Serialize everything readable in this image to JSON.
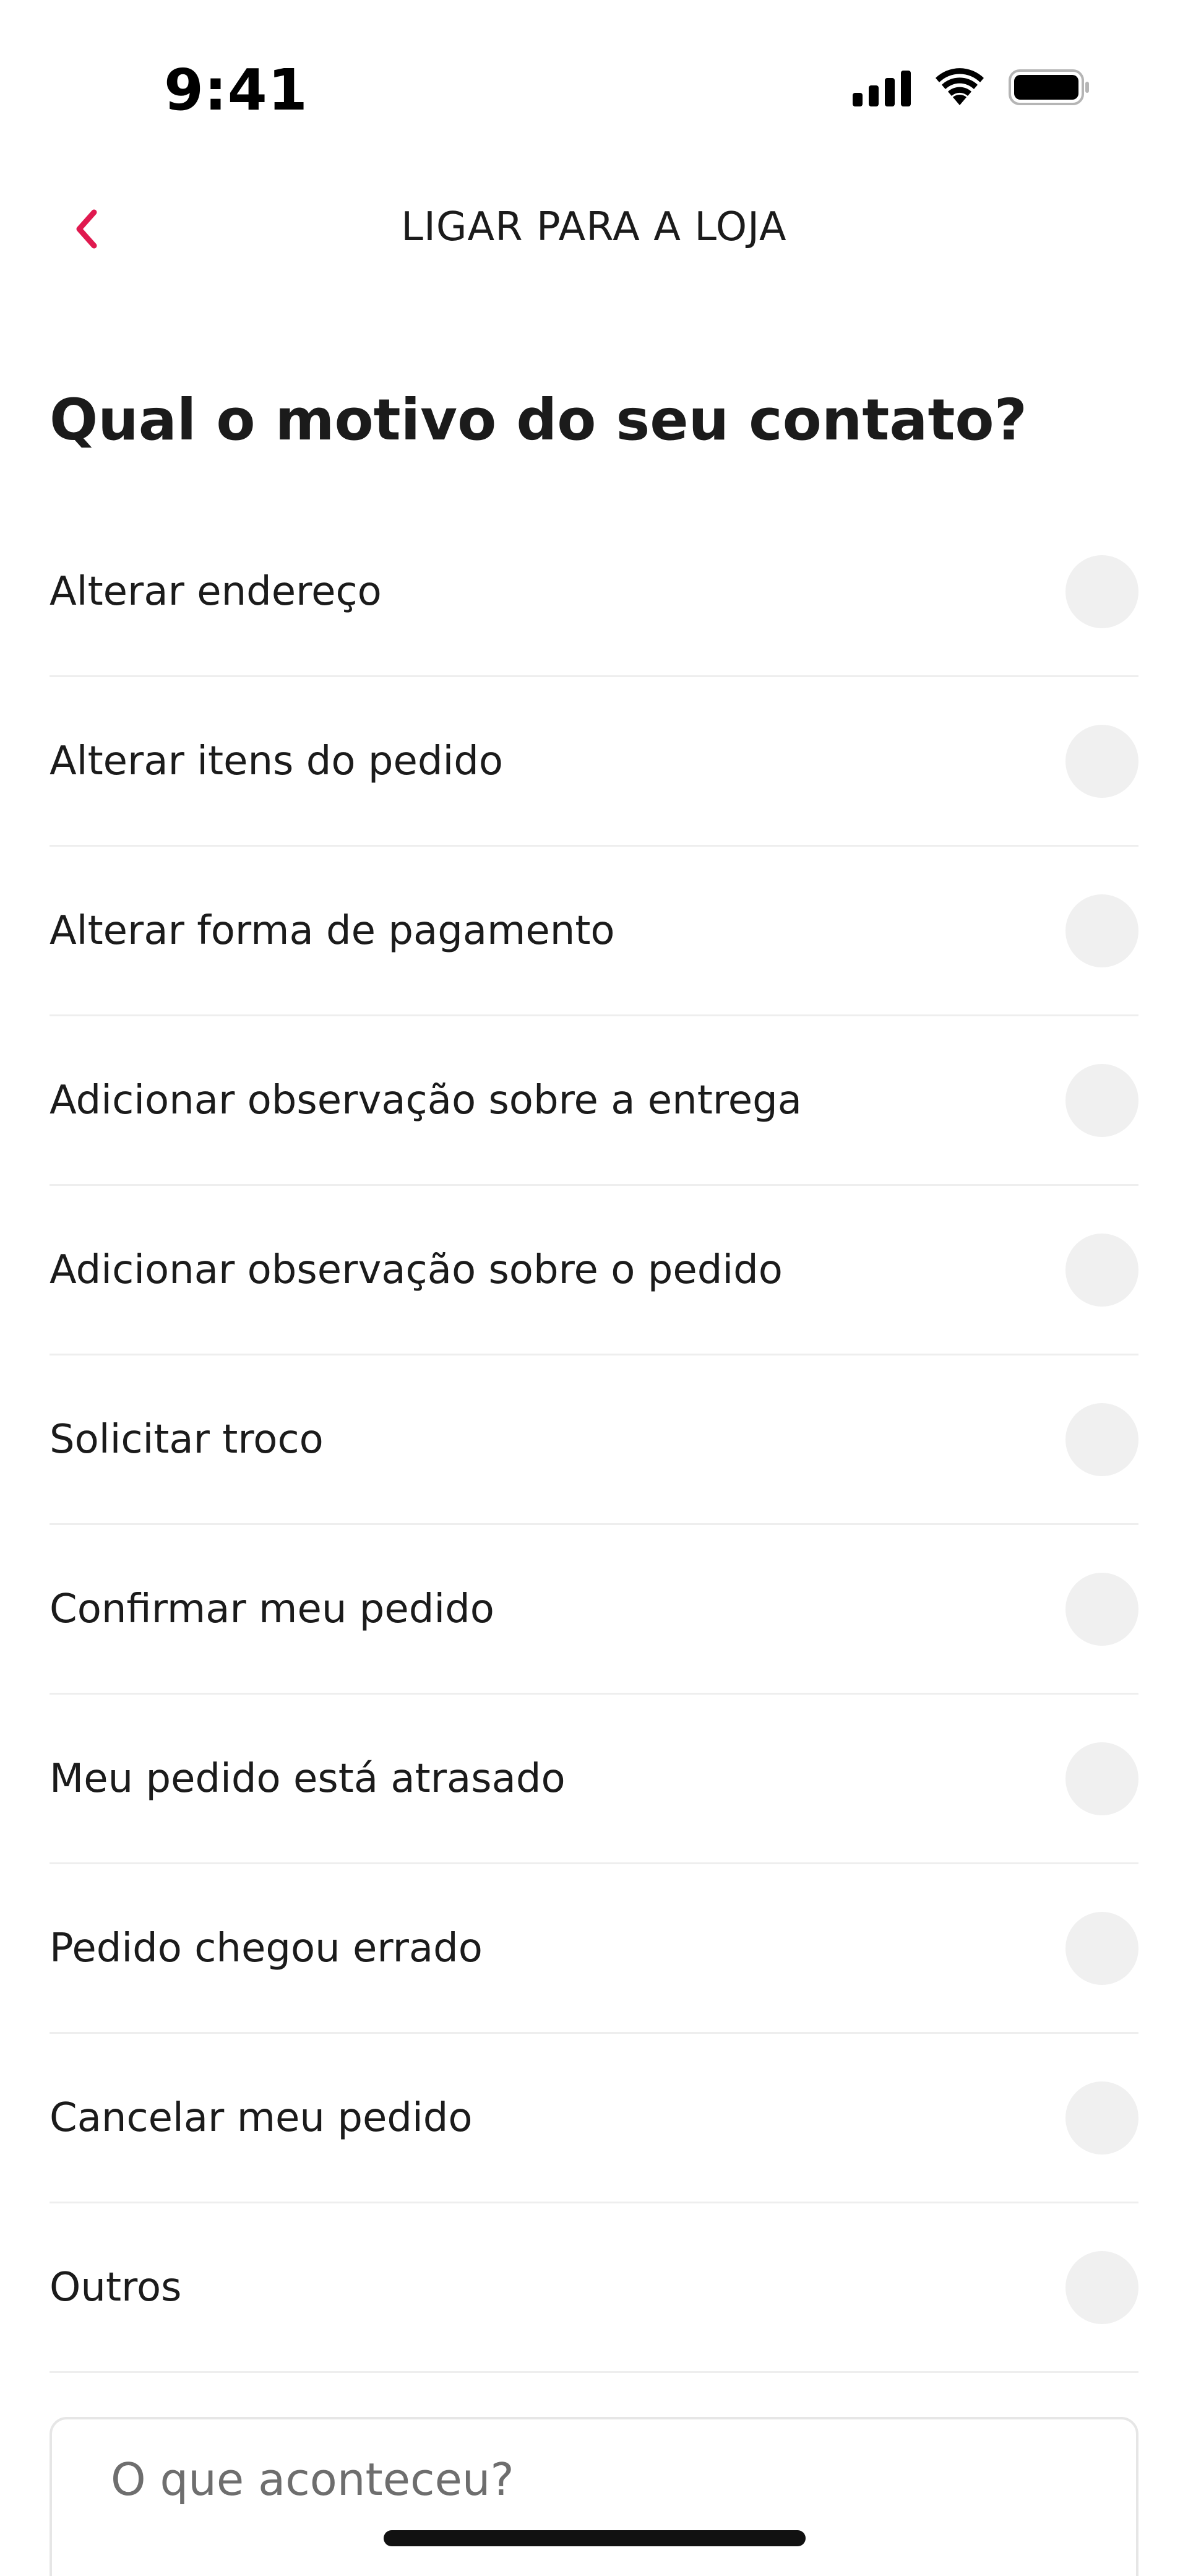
{
  "status_bar": {
    "time": "9:41",
    "icons": [
      "cellular-signal-icon",
      "wifi-icon",
      "battery-icon"
    ]
  },
  "header": {
    "back_icon": "chevron-left-icon",
    "title": "LIGAR PARA A LOJA"
  },
  "question": "Qual o motivo do seu contato?",
  "options": [
    {
      "label": "Alterar endereço",
      "selected": false
    },
    {
      "label": "Alterar itens do pedido",
      "selected": false
    },
    {
      "label": "Alterar forma de pagamento",
      "selected": false
    },
    {
      "label": "Adicionar observação sobre a entrega",
      "selected": false
    },
    {
      "label": "Adicionar observação sobre o pedido",
      "selected": false
    },
    {
      "label": "Solicitar troco",
      "selected": false
    },
    {
      "label": "Confirmar meu pedido",
      "selected": false
    },
    {
      "label": "Meu pedido está atrasado",
      "selected": false
    },
    {
      "label": "Pedido chegou errado",
      "selected": false
    },
    {
      "label": "Cancelar meu pedido",
      "selected": false
    },
    {
      "label": "Outros",
      "selected": false
    }
  ],
  "details_input": {
    "value": "",
    "placeholder": "O que aconteceu?"
  },
  "colors": {
    "accent": "#e0194f",
    "text": "#1b1b1b",
    "radio_fill": "#f0f0f0",
    "divider": "#eeeeee"
  }
}
